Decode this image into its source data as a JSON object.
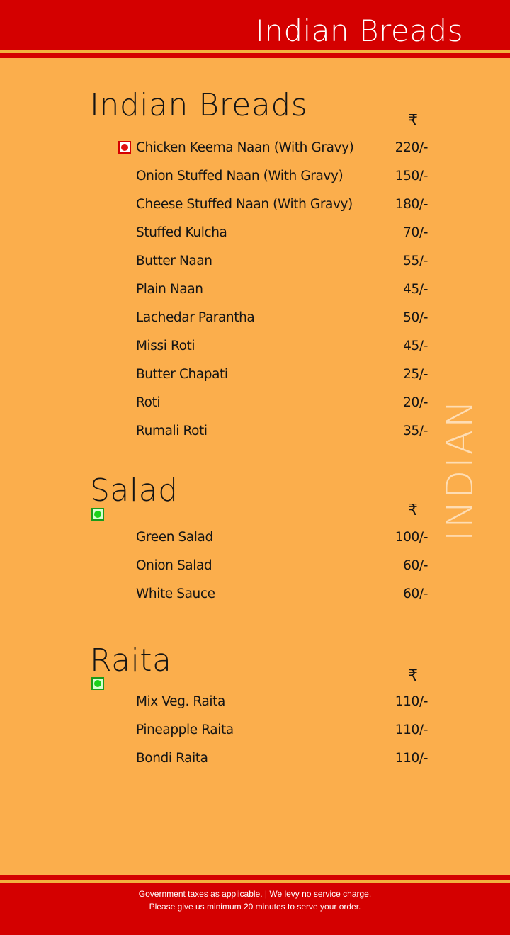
{
  "header": {
    "title": "Indian Breads"
  },
  "side_text": "INDIAN",
  "currency_symbol": "₹",
  "sections": [
    {
      "heading": "Indian Breads",
      "items": [
        {
          "name": "Chicken Keema Naan (With Gravy)",
          "price": "220/-"
        },
        {
          "name": "Onion Stuffed Naan (With Gravy)",
          "price": "150/-"
        },
        {
          "name": "Cheese Stuffed Naan (With Gravy)",
          "price": "180/-"
        },
        {
          "name": "Stuffed Kulcha",
          "price": "70/-"
        },
        {
          "name": "Butter Naan",
          "price": "55/-"
        },
        {
          "name": "Plain Naan",
          "price": "45/-"
        },
        {
          "name": "Lachedar Parantha",
          "price": "50/-"
        },
        {
          "name": "Missi Roti",
          "price": "45/-"
        },
        {
          "name": "Butter Chapati",
          "price": "25/-"
        },
        {
          "name": "Roti",
          "price": "20/-"
        },
        {
          "name": "Rumali Roti",
          "price": "35/-"
        }
      ]
    },
    {
      "heading": "Salad",
      "items": [
        {
          "name": "Green Salad",
          "price": "100/-"
        },
        {
          "name": "Onion Salad",
          "price": "60/-"
        },
        {
          "name": "White Sauce",
          "price": "60/-"
        }
      ]
    },
    {
      "heading": "Raita",
      "items": [
        {
          "name": "Mix Veg. Raita",
          "price": "110/-"
        },
        {
          "name": "Pineapple Raita",
          "price": "110/-"
        },
        {
          "name": "Bondi Raita",
          "price": "110/-"
        }
      ]
    }
  ],
  "footer": {
    "line1": "Government taxes as applicable. | We levy no service charge.",
    "line2": "Please give us minimum 20 minutes to serve your order."
  },
  "colors": {
    "band_red": "#d40000",
    "background_orange": "#fbae4c",
    "stripe_gold": "#f3b13f",
    "veg_green": "#19d319",
    "nonveg_red": "#e01010"
  },
  "icons": {
    "currency": "rupee-icon",
    "nonveg": "non-veg-marker-icon",
    "veg": "veg-marker-icon"
  }
}
